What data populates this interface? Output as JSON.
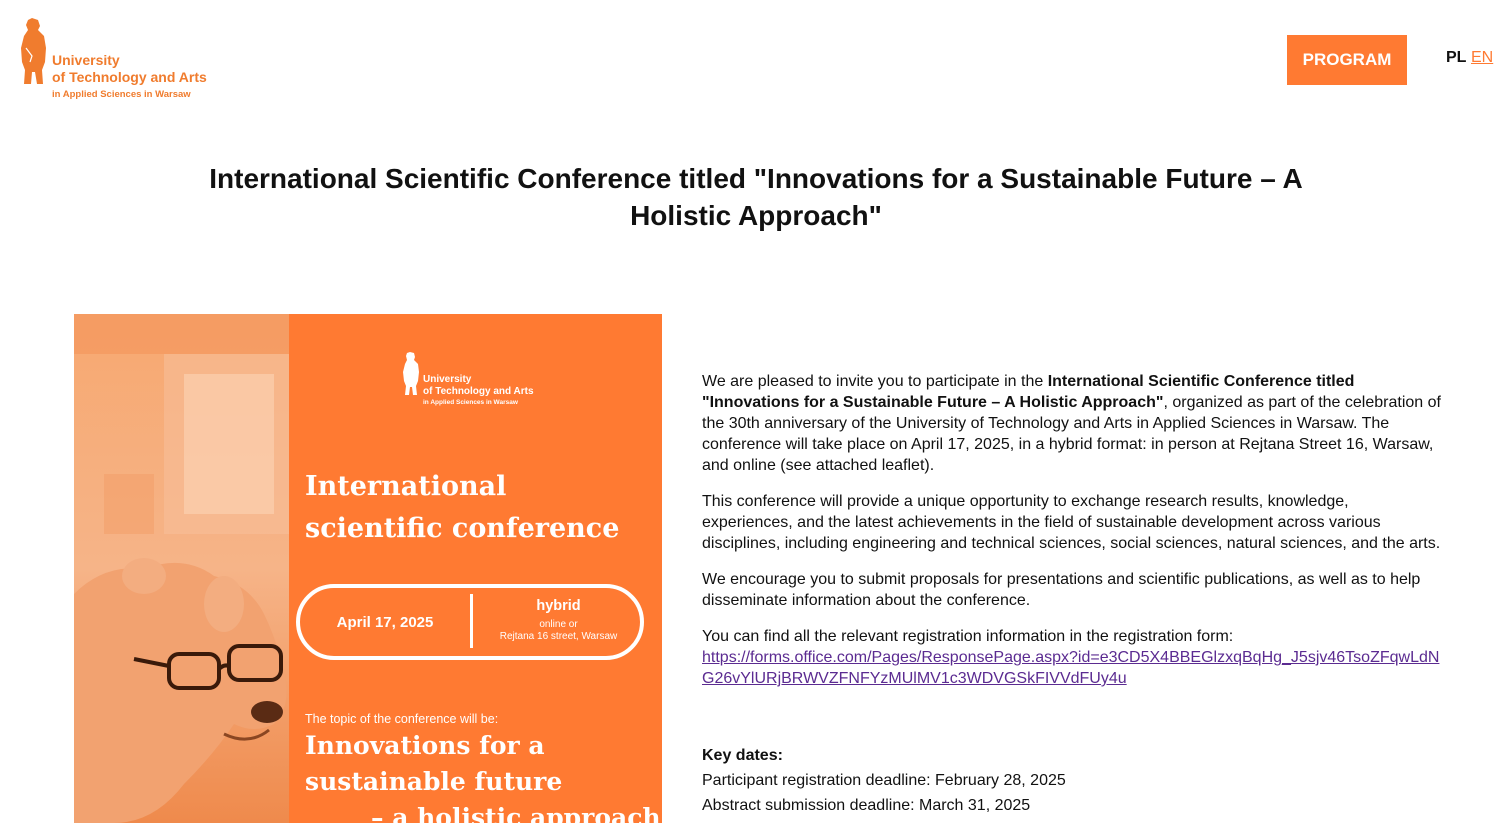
{
  "header": {
    "logo": {
      "line1": "University",
      "line2": "of Technology and Arts",
      "line3": "in Applied Sciences in Warsaw"
    },
    "program_label": "PROGRAM",
    "lang_pl": "PL",
    "lang_en": "EN"
  },
  "page_title": "International Scientific Conference titled \"Innovations for a Sustainable Future – A Holistic Approach\"",
  "leaflet": {
    "logo": {
      "line1": "University",
      "line2": "of Technology and Arts",
      "line3": "in Applied Sciences in Warsaw"
    },
    "heading_line1": "International",
    "heading_line2": "scientific conference",
    "date": "April 17, 2025",
    "format_title": "hybrid",
    "format_line1": "online or",
    "format_line2": "Rejtana 16 street, Warsaw",
    "topic_intro": "The topic of the conference will be:",
    "topic_line1": "Innovations for a",
    "topic_line2": "sustainable future",
    "topic_line3": "– a holistic approach"
  },
  "content": {
    "p1_intro": "We are pleased to invite you to participate in the ",
    "p1_bold": "International Scientific Conference titled \"Innovations for a Sustainable Future – A Holistic Approach\"",
    "p1_rest": ", organized as part of the celebration of the 30th anniversary of the University of Technology and Arts in Applied Sciences in Warsaw. The conference will take place on April 17, 2025, in a hybrid format: in person at Rejtana Street 16, Warsaw, and online (see attached leaflet).",
    "p2": "This conference will provide a unique opportunity to exchange research results, knowledge, experiences, and the latest achievements in the field of sustainable development across various disciplines, including engineering and technical sciences, social sciences, natural sciences, and the arts.",
    "p3": "We encourage you to submit proposals for presentations and scientific publications, as well as to help disseminate information about the conference.",
    "p4": "You can find all the relevant registration information in the registration form:",
    "registration_link": "https://forms.office.com/Pages/ResponsePage.aspx?id=e3CD5X4BBEGlzxqBqHg_J5sjv46TsoZFqwLdNG26vYlURjBRWVZFNFYzMUlMV1c3WDVGSkFIVVdFUy4u",
    "key_dates_title": "Key dates:",
    "key_date_1": "Participant registration deadline: February 28, 2025",
    "key_date_2": "Abstract submission deadline: March 31, 2025"
  },
  "colors": {
    "accent": "#ff7a32",
    "logo": "#f07c2e",
    "link": "#5b2b91"
  }
}
